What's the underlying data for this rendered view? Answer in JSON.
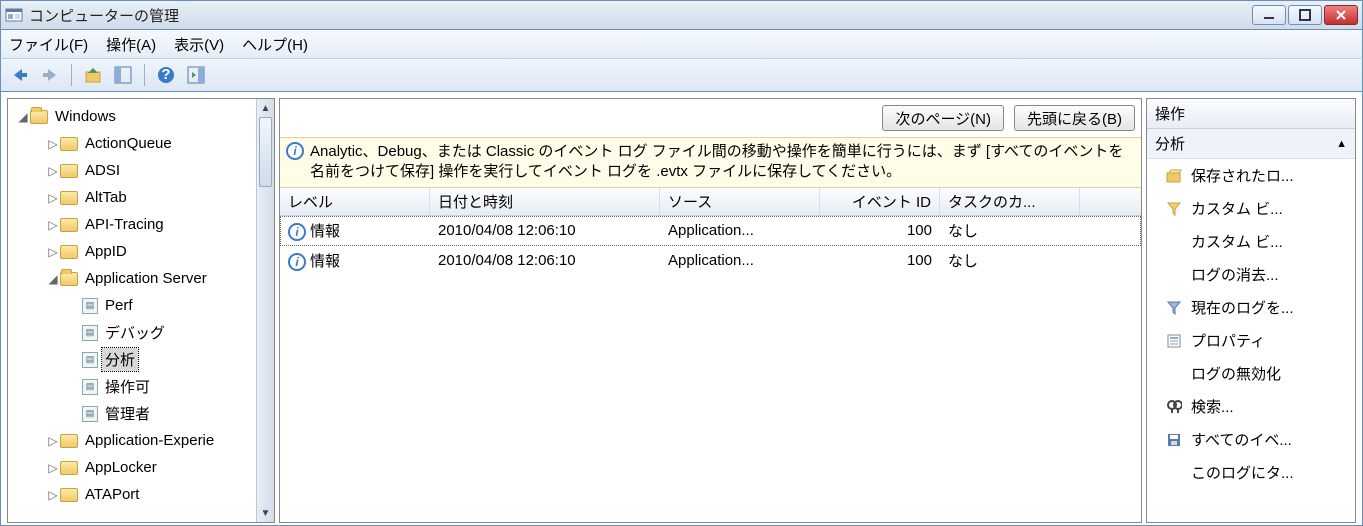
{
  "window": {
    "title": "コンピューターの管理"
  },
  "menu": {
    "file": "ファイル(F)",
    "action": "操作(A)",
    "view": "表示(V)",
    "help": "ヘルプ(H)"
  },
  "tree": {
    "root": "Windows",
    "items": [
      "ActionQueue",
      "ADSI",
      "AltTab",
      "API-Tracing",
      "AppID"
    ],
    "expanded": "Application Server",
    "leaves": [
      "Perf",
      "デバッグ",
      "分析",
      "操作可",
      "管理者"
    ],
    "after": [
      "Application-Experie",
      "AppLocker",
      "ATAPort"
    ]
  },
  "center": {
    "btn_next": "次のページ(N)",
    "btn_top": "先頭に戻る(B)",
    "info": "Analytic、Debug、または Classic のイベント ログ ファイル間の移動や操作を簡単に行うには、まず [すべてのイベントを名前をつけて保存] 操作を実行してイベント ログを .evtx ファイルに保存してください。",
    "headers": {
      "level": "レベル",
      "datetime": "日付と時刻",
      "source": "ソース",
      "eventid": "イベント ID",
      "category": "タスクのカ..."
    },
    "rows": [
      {
        "level": "情報",
        "datetime": "2010/04/08 12:06:10",
        "source": "Application...",
        "eventid": "100",
        "category": "なし"
      },
      {
        "level": "情報",
        "datetime": "2010/04/08 12:06:10",
        "source": "Application...",
        "eventid": "100",
        "category": "なし"
      }
    ]
  },
  "actions": {
    "title": "操作",
    "group": "分析",
    "items": [
      {
        "icon": "open",
        "label": "保存されたロ..."
      },
      {
        "icon": "filter",
        "label": "カスタム ビ..."
      },
      {
        "icon": "",
        "label": "カスタム ビ..."
      },
      {
        "icon": "",
        "label": "ログの消去..."
      },
      {
        "icon": "funnel",
        "label": "現在のログを..."
      },
      {
        "icon": "props",
        "label": "プロパティ"
      },
      {
        "icon": "",
        "label": "ログの無効化"
      },
      {
        "icon": "search",
        "label": "検索..."
      },
      {
        "icon": "save",
        "label": "すべてのイベ..."
      },
      {
        "icon": "",
        "label": "このログにタ..."
      }
    ]
  }
}
